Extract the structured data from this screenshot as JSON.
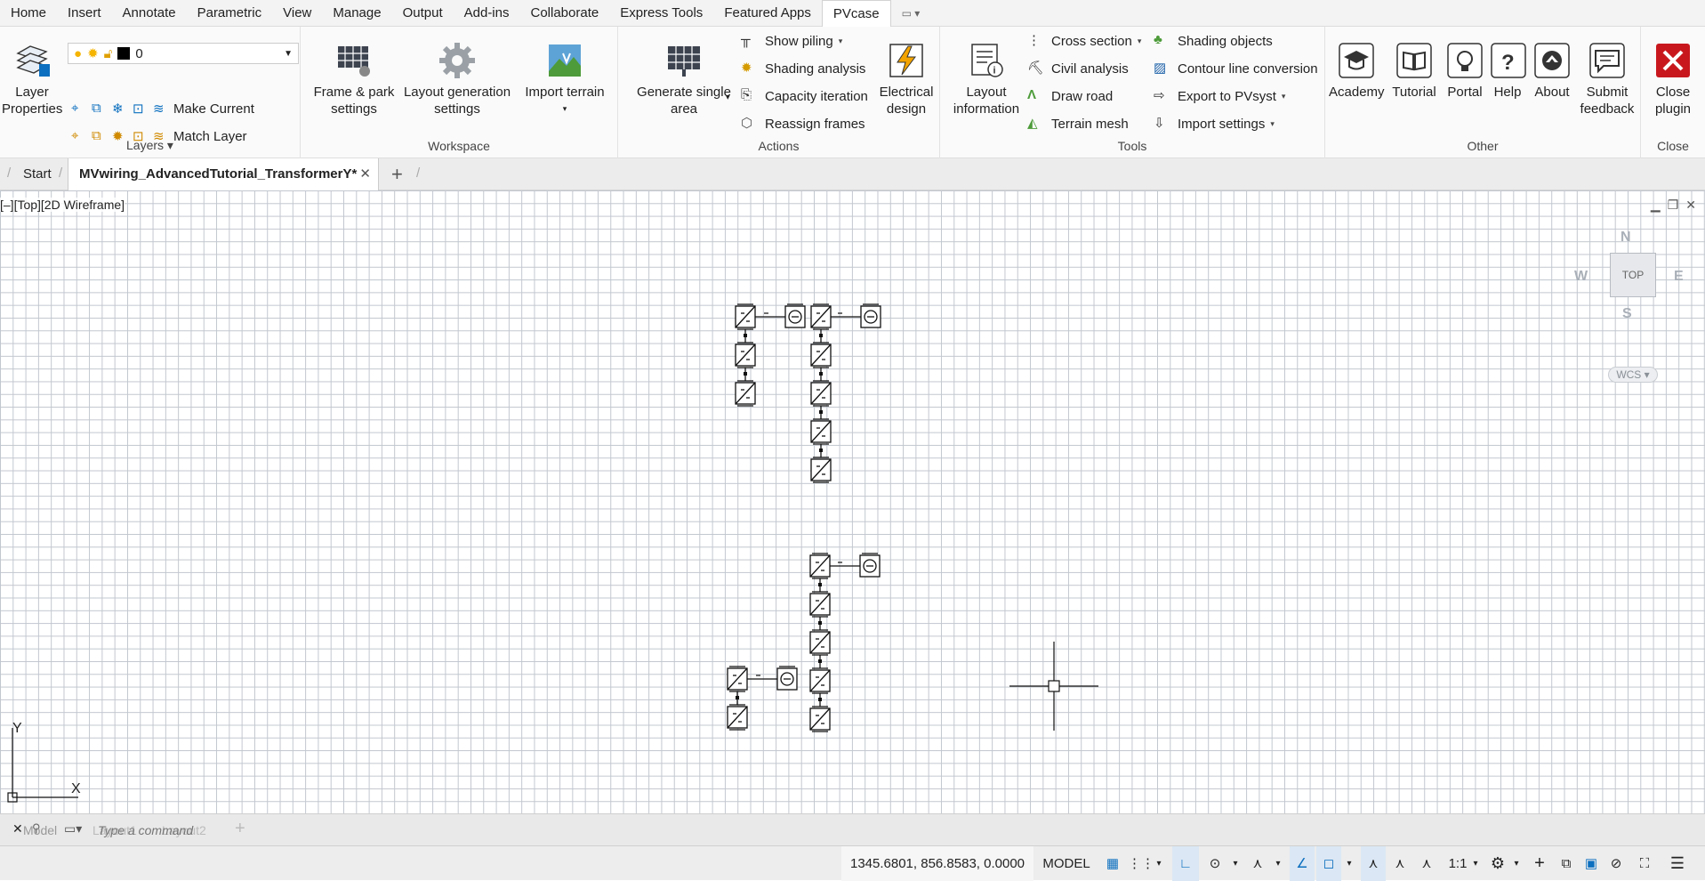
{
  "menu": {
    "tabs": [
      "Home",
      "Insert",
      "Annotate",
      "Parametric",
      "View",
      "Manage",
      "Output",
      "Add-ins",
      "Collaborate",
      "Express Tools",
      "Featured Apps",
      "PVcase"
    ],
    "active": "PVcase",
    "qat_icon": "quick-access-dropdown"
  },
  "ribbon": {
    "layers": {
      "title": "Layers",
      "big": "Layer\nProperties",
      "current_layer": "0",
      "make_current": "Make Current",
      "match_layer": "Match Layer"
    },
    "workspace": {
      "title": "Workspace",
      "frame": "Frame & park\nsettings",
      "layout_gen": "Layout generation\nsettings",
      "import_terrain": "Import terrain"
    },
    "actions": {
      "title": "Actions",
      "generate": "Generate single\narea",
      "show_piling": "Show piling",
      "shading_analysis": "Shading analysis",
      "capacity_iteration": "Capacity iteration",
      "reassign_frames": "Reassign frames",
      "electrical": "Electrical\ndesign"
    },
    "tools": {
      "title": "Tools",
      "layout_info": "Layout\ninformation",
      "cross_section": "Cross section",
      "civil_analysis": "Civil analysis",
      "draw_road": "Draw road",
      "terrain_mesh": "Terrain mesh",
      "shading_objects": "Shading objects",
      "contour_line": "Contour line conversion",
      "export_pvsyst": "Export to PVsyst",
      "import_settings": "Import settings"
    },
    "other": {
      "title": "Other",
      "academy": "Academy",
      "tutorial": "Tutorial",
      "portal": "Portal",
      "help": "Help",
      "about": "About",
      "feedback": "Submit\nfeedback"
    },
    "close": {
      "title": "Close",
      "plugin": "Close\nplugin"
    }
  },
  "doc_tabs": {
    "start": "Start",
    "active": "MVwiring_AdvancedTutorial_TransformerY*"
  },
  "viewport": {
    "label": "[–][Top][2D Wireframe]",
    "viewcube": {
      "top": "TOP",
      "n": "N",
      "s": "S",
      "e": "E",
      "w": "W",
      "wcs": "WCS"
    },
    "ucs": {
      "x": "X",
      "y": "Y"
    }
  },
  "command": {
    "placeholder": "Type a command",
    "layout_tabs": [
      "Model",
      "Layout1",
      "Layout2"
    ]
  },
  "status": {
    "coords": "1345.6801, 856.8583, 0.0000",
    "space": "MODEL",
    "scale": "1:1"
  },
  "colors": {
    "accent": "#0c6fbf",
    "close_red": "#c8181e",
    "grid": "#c2c7cf"
  }
}
